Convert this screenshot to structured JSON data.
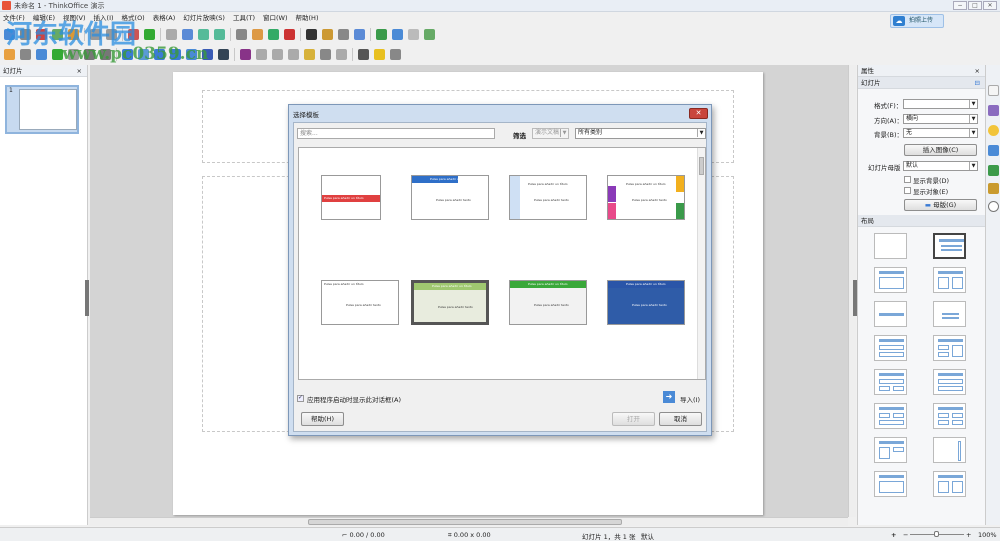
{
  "window": {
    "title": "未命名 1 - ThinkOffice 演示",
    "upload_label": "拍照上传",
    "minimize": "−",
    "maximize": "□",
    "close": "✕"
  },
  "menu": [
    "文件(F)",
    "编辑(E)",
    "视图(V)",
    "插入(I)",
    "格式(O)",
    "表格(A)",
    "幻灯片放映(S)",
    "工具(T)",
    "窗口(W)",
    "帮助(H)"
  ],
  "watermark": {
    "name": "河东软件园",
    "url": "www.pc0359.cn"
  },
  "slides_panel": {
    "title": "幻灯片",
    "close": "×",
    "slide_number": "1"
  },
  "properties": {
    "title": "属性",
    "close": "×",
    "section_slide": "幻灯片",
    "format_label": "格式(F)：",
    "format_value": "",
    "orientation_label": "方向(A)：",
    "orientation_value": "横向",
    "background_label": "背景(B)：",
    "background_value": "无",
    "insert_image": "插入图像(C)",
    "master_label": "幻灯片母版",
    "master_value": "默认",
    "show_background": "显示背景(D)",
    "show_objects": "显示对象(E)",
    "master_button": "母版(G)",
    "section_layout": "布局"
  },
  "dialog": {
    "title": "选择模板",
    "close": "✕",
    "search_placeholder": "搜索...",
    "filter_label": "筛选",
    "doc_type": "演示文稿",
    "category": "所有类别",
    "templates": [
      {
        "title": "Pulsa para añadir un título",
        "body": ""
      },
      {
        "title": "Pulsa para añadir un título",
        "body": "Pulsa para añadir texto"
      },
      {
        "title": "Pulsa para añadir un título",
        "body": "Pulsa para añadir texto"
      },
      {
        "title": "Pulsa para añadir un título",
        "body": "Pulsa para añadir texto"
      },
      {
        "title": "Pulsa para añadir un título",
        "body": "Pulsa para añadir texto"
      },
      {
        "title": "Pulsa para añadir un título",
        "body": "Pulsa para añadir texto"
      },
      {
        "title": "Pulsa para añadir un título",
        "body": "Pulsa para añadir texto"
      },
      {
        "title": "Pulsa para añadir un título",
        "body": "Pulsa para añadir texto"
      }
    ],
    "show_on_startup": "应用程序启动时显示此对话框(A)",
    "show_on_startup_checked": true,
    "import": "导入(I)",
    "help": "帮助(H)",
    "open": "打开",
    "cancel": "取消"
  },
  "status": {
    "position": "0.00 / 0.00",
    "size": "0.00 x 0.00",
    "slide_info": "幻灯片 1，共 1 张",
    "master": "默认",
    "zoom": "100%",
    "zoom_in": "+",
    "zoom_out": "−"
  }
}
